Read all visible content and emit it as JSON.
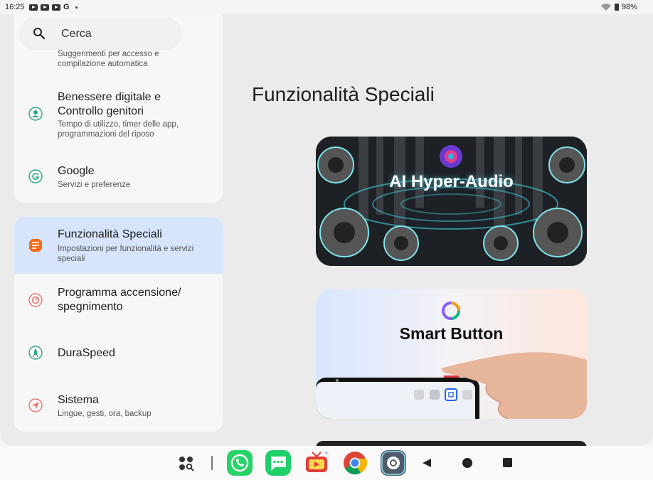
{
  "status_bar": {
    "time": "16:25",
    "g_label": "G",
    "battery": "98%"
  },
  "search": {
    "placeholder": "Cerca"
  },
  "settings_items": [
    {
      "title": "",
      "subtitle": "Suggerimenti per accesso e compilazione automatica"
    },
    {
      "title": "Benessere digitale e Controllo genitori",
      "subtitle": "Tempo di utilizzo, timer delle app, programmazioni del riposo",
      "icon": "digital-wellbeing-icon"
    },
    {
      "title": "Google",
      "subtitle": "Servizi e preferenze",
      "icon": "google-icon"
    },
    {
      "title": "Funzionalità Speciali",
      "subtitle": "Impostazioni per funzionalità e servizi speciali",
      "icon": "special-features-icon",
      "selected": true
    },
    {
      "title": "Programma accensione/ spegnimento",
      "subtitle": "",
      "icon": "power-schedule-icon"
    },
    {
      "title": "DuraSpeed",
      "subtitle": "",
      "icon": "rocket-icon"
    },
    {
      "title": "Sistema",
      "subtitle": "Lingue, gesti, ora, backup",
      "icon": "system-icon"
    }
  ],
  "detail": {
    "title": "Funzionalità Speciali",
    "banners": [
      {
        "text": "AI Hyper-Audio"
      },
      {
        "text": "Smart Button"
      }
    ]
  },
  "colors": {
    "selected_bg": "#d6e4fc",
    "accent_orange": "#f26d1c",
    "teal_icon": "#2aa58a",
    "whatsapp_green": "#25d366"
  }
}
